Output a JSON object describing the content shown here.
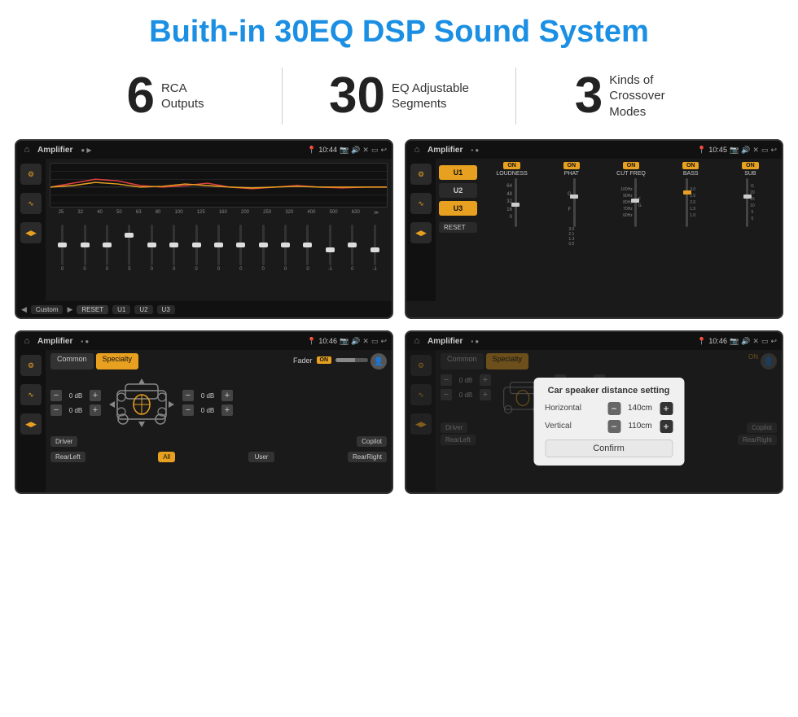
{
  "page": {
    "title": "Buith-in 30EQ DSP Sound System",
    "background": "#ffffff"
  },
  "stats": [
    {
      "number": "6",
      "label": "RCA\nOutputs"
    },
    {
      "number": "30",
      "label": "EQ Adjustable\nSegments"
    },
    {
      "number": "3",
      "label": "Kinds of\nCrossover Modes"
    }
  ],
  "screens": [
    {
      "id": "screen1",
      "status_bar": {
        "title": "Amplifier",
        "time": "10:44",
        "indicators": "▶"
      }
    },
    {
      "id": "screen2",
      "status_bar": {
        "title": "Amplifier",
        "time": "10:45",
        "indicators": "▪"
      }
    },
    {
      "id": "screen3",
      "status_bar": {
        "title": "Amplifier",
        "time": "10:46",
        "indicators": "▪"
      }
    },
    {
      "id": "screen4",
      "status_bar": {
        "title": "Amplifier",
        "time": "10:46",
        "indicators": "▪"
      },
      "dialog": {
        "title": "Car speaker distance setting",
        "horizontal_label": "Horizontal",
        "horizontal_value": "140cm",
        "vertical_label": "Vertical",
        "vertical_value": "110cm",
        "confirm_label": "Confirm"
      }
    }
  ],
  "eq": {
    "frequencies": [
      "25",
      "32",
      "40",
      "50",
      "63",
      "80",
      "100",
      "125",
      "160",
      "200",
      "250",
      "320",
      "400",
      "500",
      "630"
    ],
    "values": [
      "0",
      "0",
      "0",
      "5",
      "0",
      "0",
      "0",
      "0",
      "0",
      "0",
      "0",
      "0",
      "-1",
      "0",
      "-1"
    ],
    "presets": [
      "Custom",
      "RESET",
      "U1",
      "U2",
      "U3"
    ]
  },
  "modes": {
    "panels": [
      "U1",
      "U2",
      "U3"
    ],
    "knobs": [
      "LOUDNESS",
      "PHAT",
      "CUT FREQ",
      "BASS",
      "SUB"
    ],
    "reset_label": "RESET"
  },
  "speaker": {
    "tabs": [
      "Common",
      "Specialty"
    ],
    "fader_label": "Fader",
    "on_label": "ON",
    "db_values": [
      "0 dB",
      "0 dB",
      "0 dB",
      "0 dB"
    ],
    "buttons": [
      "Driver",
      "Copilot",
      "RearLeft",
      "All",
      "User",
      "RearRight"
    ]
  }
}
